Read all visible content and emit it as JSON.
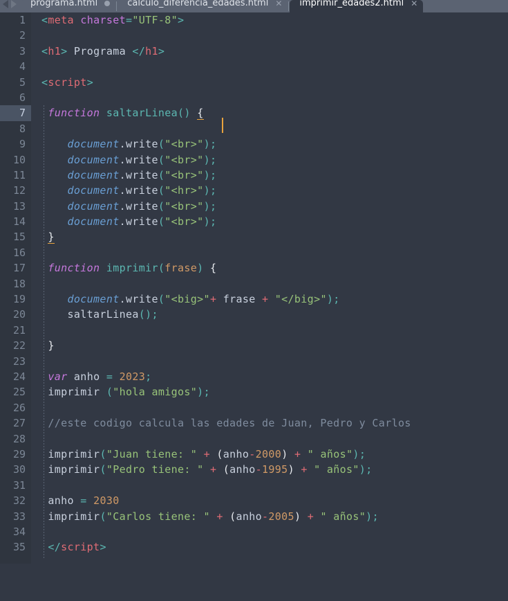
{
  "window": {
    "app": "code-editor",
    "theme_background": "#323844",
    "gutter_background": "#2f353f",
    "current_line_highlight": "#4a5464",
    "caret_color": "#e8a33d"
  },
  "tabbar": {
    "nav_prev_icon": "arrow-left-icon",
    "nav_next_icon": "arrow-right-icon",
    "tabs": [
      {
        "label": "programa.html",
        "active": false,
        "modified": true,
        "close_icon": "close-icon"
      },
      {
        "label": "calculo_diferencia_edades.html",
        "active": false,
        "modified": false,
        "close_icon": "close-icon"
      },
      {
        "label": "imprimir_edades2.html",
        "active": true,
        "modified": false,
        "close_icon": "close-icon"
      }
    ]
  },
  "editor": {
    "current_line": 7,
    "cursor_text": "function saltarLinea() {",
    "total_lines": 35,
    "lines": [
      {
        "n": "1",
        "tokens": [
          {
            "t": "<",
            "c": "punct"
          },
          {
            "t": "meta",
            "c": "tag"
          },
          {
            "t": " ",
            "c": "plain"
          },
          {
            "t": "charset",
            "c": "attr"
          },
          {
            "t": "=",
            "c": "punct"
          },
          {
            "t": "\"UTF-8\"",
            "c": "str"
          },
          {
            "t": ">",
            "c": "punct"
          }
        ]
      },
      {
        "n": "2",
        "tokens": []
      },
      {
        "n": "3",
        "tokens": [
          {
            "t": "<",
            "c": "punct"
          },
          {
            "t": "h1",
            "c": "tag"
          },
          {
            "t": ">",
            "c": "punct"
          },
          {
            "t": " Programa ",
            "c": "plain"
          },
          {
            "t": "</",
            "c": "punct"
          },
          {
            "t": "h1",
            "c": "tag"
          },
          {
            "t": ">",
            "c": "punct"
          }
        ]
      },
      {
        "n": "4",
        "tokens": []
      },
      {
        "n": "5",
        "tokens": [
          {
            "t": "<",
            "c": "punct"
          },
          {
            "t": "script",
            "c": "tag"
          },
          {
            "t": ">",
            "c": "punct"
          }
        ]
      },
      {
        "n": "6",
        "tokens": []
      },
      {
        "n": "7",
        "tokens": [
          {
            "t": " ",
            "c": "plain"
          },
          {
            "t": "function",
            "c": "kw"
          },
          {
            "t": " ",
            "c": "plain"
          },
          {
            "t": "saltarLinea",
            "c": "fn"
          },
          {
            "t": "()",
            "c": "paren"
          },
          {
            "t": " ",
            "c": "plain"
          },
          {
            "t": "{",
            "c": "brace matched"
          }
        ]
      },
      {
        "n": "8",
        "tokens": []
      },
      {
        "n": "9",
        "tokens": [
          {
            "t": "    ",
            "c": "plain"
          },
          {
            "t": "document",
            "c": "obj"
          },
          {
            "t": ".",
            "c": "prop"
          },
          {
            "t": "write",
            "c": "prop"
          },
          {
            "t": "(",
            "c": "paren"
          },
          {
            "t": "\"<br>\"",
            "c": "str"
          },
          {
            "t": ")",
            "c": "paren"
          },
          {
            "t": ";",
            "c": "paren"
          }
        ]
      },
      {
        "n": "10",
        "tokens": [
          {
            "t": "    ",
            "c": "plain"
          },
          {
            "t": "document",
            "c": "obj"
          },
          {
            "t": ".",
            "c": "prop"
          },
          {
            "t": "write",
            "c": "prop"
          },
          {
            "t": "(",
            "c": "paren"
          },
          {
            "t": "\"<br>\"",
            "c": "str"
          },
          {
            "t": ")",
            "c": "paren"
          },
          {
            "t": ";",
            "c": "paren"
          }
        ]
      },
      {
        "n": "11",
        "tokens": [
          {
            "t": "    ",
            "c": "plain"
          },
          {
            "t": "document",
            "c": "obj"
          },
          {
            "t": ".",
            "c": "prop"
          },
          {
            "t": "write",
            "c": "prop"
          },
          {
            "t": "(",
            "c": "paren"
          },
          {
            "t": "\"<br>\"",
            "c": "str"
          },
          {
            "t": ")",
            "c": "paren"
          },
          {
            "t": ";",
            "c": "paren"
          }
        ]
      },
      {
        "n": "12",
        "tokens": [
          {
            "t": "    ",
            "c": "plain"
          },
          {
            "t": "document",
            "c": "obj"
          },
          {
            "t": ".",
            "c": "prop"
          },
          {
            "t": "write",
            "c": "prop"
          },
          {
            "t": "(",
            "c": "paren"
          },
          {
            "t": "\"<hr>\"",
            "c": "str"
          },
          {
            "t": ")",
            "c": "paren"
          },
          {
            "t": ";",
            "c": "paren"
          }
        ]
      },
      {
        "n": "13",
        "tokens": [
          {
            "t": "    ",
            "c": "plain"
          },
          {
            "t": "document",
            "c": "obj"
          },
          {
            "t": ".",
            "c": "prop"
          },
          {
            "t": "write",
            "c": "prop"
          },
          {
            "t": "(",
            "c": "paren"
          },
          {
            "t": "\"<br>\"",
            "c": "str"
          },
          {
            "t": ")",
            "c": "paren"
          },
          {
            "t": ";",
            "c": "paren"
          }
        ]
      },
      {
        "n": "14",
        "tokens": [
          {
            "t": "    ",
            "c": "plain"
          },
          {
            "t": "document",
            "c": "obj"
          },
          {
            "t": ".",
            "c": "prop"
          },
          {
            "t": "write",
            "c": "prop"
          },
          {
            "t": "(",
            "c": "paren"
          },
          {
            "t": "\"<br>\"",
            "c": "str"
          },
          {
            "t": ")",
            "c": "paren"
          },
          {
            "t": ";",
            "c": "paren"
          }
        ]
      },
      {
        "n": "15",
        "tokens": [
          {
            "t": " ",
            "c": "plain"
          },
          {
            "t": "}",
            "c": "brace matched"
          }
        ]
      },
      {
        "n": "16",
        "tokens": []
      },
      {
        "n": "17",
        "tokens": [
          {
            "t": " ",
            "c": "plain"
          },
          {
            "t": "function",
            "c": "kw"
          },
          {
            "t": " ",
            "c": "plain"
          },
          {
            "t": "imprimir",
            "c": "fn"
          },
          {
            "t": "(",
            "c": "paren"
          },
          {
            "t": "frase",
            "c": "param"
          },
          {
            "t": ")",
            "c": "paren"
          },
          {
            "t": " ",
            "c": "plain"
          },
          {
            "t": "{",
            "c": "brace"
          }
        ]
      },
      {
        "n": "18",
        "tokens": []
      },
      {
        "n": "19",
        "tokens": [
          {
            "t": "    ",
            "c": "plain"
          },
          {
            "t": "document",
            "c": "obj"
          },
          {
            "t": ".",
            "c": "prop"
          },
          {
            "t": "write",
            "c": "prop"
          },
          {
            "t": "(",
            "c": "paren"
          },
          {
            "t": "\"<big>\"",
            "c": "str"
          },
          {
            "t": "+",
            "c": "op"
          },
          {
            "t": " frase ",
            "c": "plain"
          },
          {
            "t": "+",
            "c": "op"
          },
          {
            "t": " ",
            "c": "plain"
          },
          {
            "t": "\"</big>\"",
            "c": "str"
          },
          {
            "t": ")",
            "c": "paren"
          },
          {
            "t": ";",
            "c": "paren"
          }
        ]
      },
      {
        "n": "20",
        "tokens": [
          {
            "t": "    ",
            "c": "plain"
          },
          {
            "t": "saltarLinea",
            "c": "prop"
          },
          {
            "t": "()",
            "c": "paren"
          },
          {
            "t": ";",
            "c": "paren"
          }
        ]
      },
      {
        "n": "21",
        "tokens": []
      },
      {
        "n": "22",
        "tokens": [
          {
            "t": " ",
            "c": "plain"
          },
          {
            "t": "}",
            "c": "brace"
          }
        ]
      },
      {
        "n": "23",
        "tokens": []
      },
      {
        "n": "24",
        "tokens": [
          {
            "t": " ",
            "c": "plain"
          },
          {
            "t": "var",
            "c": "kw"
          },
          {
            "t": " anho ",
            "c": "plain"
          },
          {
            "t": "=",
            "c": "punct"
          },
          {
            "t": " ",
            "c": "plain"
          },
          {
            "t": "2023",
            "c": "num"
          },
          {
            "t": ";",
            "c": "paren"
          }
        ]
      },
      {
        "n": "25",
        "tokens": [
          {
            "t": " ",
            "c": "plain"
          },
          {
            "t": "imprimir",
            "c": "prop"
          },
          {
            "t": " ",
            "c": "plain"
          },
          {
            "t": "(",
            "c": "paren"
          },
          {
            "t": "\"hola amigos\"",
            "c": "str"
          },
          {
            "t": ")",
            "c": "paren"
          },
          {
            "t": ";",
            "c": "paren"
          }
        ]
      },
      {
        "n": "26",
        "tokens": []
      },
      {
        "n": "27",
        "tokens": [
          {
            "t": " ",
            "c": "plain"
          },
          {
            "t": "//este codigo calcula las edades de Juan, Pedro y Carlos",
            "c": "comment"
          }
        ]
      },
      {
        "n": "28",
        "tokens": []
      },
      {
        "n": "29",
        "tokens": [
          {
            "t": " ",
            "c": "plain"
          },
          {
            "t": "imprimir",
            "c": "prop"
          },
          {
            "t": "(",
            "c": "paren"
          },
          {
            "t": "\"Juan tiene: \"",
            "c": "str"
          },
          {
            "t": " ",
            "c": "plain"
          },
          {
            "t": "+",
            "c": "op"
          },
          {
            "t": " ",
            "c": "plain"
          },
          {
            "t": "(",
            "c": "brace"
          },
          {
            "t": "anho",
            "c": "plain"
          },
          {
            "t": "-",
            "c": "op"
          },
          {
            "t": "2000",
            "c": "num"
          },
          {
            "t": ")",
            "c": "brace"
          },
          {
            "t": " ",
            "c": "plain"
          },
          {
            "t": "+",
            "c": "op"
          },
          {
            "t": " ",
            "c": "plain"
          },
          {
            "t": "\" años\"",
            "c": "str"
          },
          {
            "t": ")",
            "c": "paren"
          },
          {
            "t": ";",
            "c": "paren"
          }
        ]
      },
      {
        "n": "30",
        "tokens": [
          {
            "t": " ",
            "c": "plain"
          },
          {
            "t": "imprimir",
            "c": "prop"
          },
          {
            "t": "(",
            "c": "paren"
          },
          {
            "t": "\"Pedro tiene: \"",
            "c": "str"
          },
          {
            "t": " ",
            "c": "plain"
          },
          {
            "t": "+",
            "c": "op"
          },
          {
            "t": " ",
            "c": "plain"
          },
          {
            "t": "(",
            "c": "brace"
          },
          {
            "t": "anho",
            "c": "plain"
          },
          {
            "t": "-",
            "c": "op"
          },
          {
            "t": "1995",
            "c": "num"
          },
          {
            "t": ")",
            "c": "brace"
          },
          {
            "t": " ",
            "c": "plain"
          },
          {
            "t": "+",
            "c": "op"
          },
          {
            "t": " ",
            "c": "plain"
          },
          {
            "t": "\" años\"",
            "c": "str"
          },
          {
            "t": ")",
            "c": "paren"
          },
          {
            "t": ";",
            "c": "paren"
          }
        ]
      },
      {
        "n": "31",
        "tokens": []
      },
      {
        "n": "32",
        "tokens": [
          {
            "t": " anho ",
            "c": "plain"
          },
          {
            "t": "=",
            "c": "punct"
          },
          {
            "t": " ",
            "c": "plain"
          },
          {
            "t": "2030",
            "c": "num"
          }
        ]
      },
      {
        "n": "33",
        "tokens": [
          {
            "t": " ",
            "c": "plain"
          },
          {
            "t": "imprimir",
            "c": "prop"
          },
          {
            "t": "(",
            "c": "paren"
          },
          {
            "t": "\"Carlos tiene: \"",
            "c": "str"
          },
          {
            "t": " ",
            "c": "plain"
          },
          {
            "t": "+",
            "c": "op"
          },
          {
            "t": " ",
            "c": "plain"
          },
          {
            "t": "(",
            "c": "brace"
          },
          {
            "t": "anho",
            "c": "plain"
          },
          {
            "t": "-",
            "c": "op"
          },
          {
            "t": "2005",
            "c": "num"
          },
          {
            "t": ")",
            "c": "brace"
          },
          {
            "t": " ",
            "c": "plain"
          },
          {
            "t": "+",
            "c": "op"
          },
          {
            "t": " ",
            "c": "plain"
          },
          {
            "t": "\" años\"",
            "c": "str"
          },
          {
            "t": ")",
            "c": "paren"
          },
          {
            "t": ";",
            "c": "paren"
          }
        ]
      },
      {
        "n": "34",
        "tokens": []
      },
      {
        "n": "35",
        "tokens": [
          {
            "t": " ",
            "c": "plain"
          },
          {
            "t": "</",
            "c": "punct"
          },
          {
            "t": "script",
            "c": "tag"
          },
          {
            "t": ">",
            "c": "punct"
          }
        ]
      }
    ]
  }
}
